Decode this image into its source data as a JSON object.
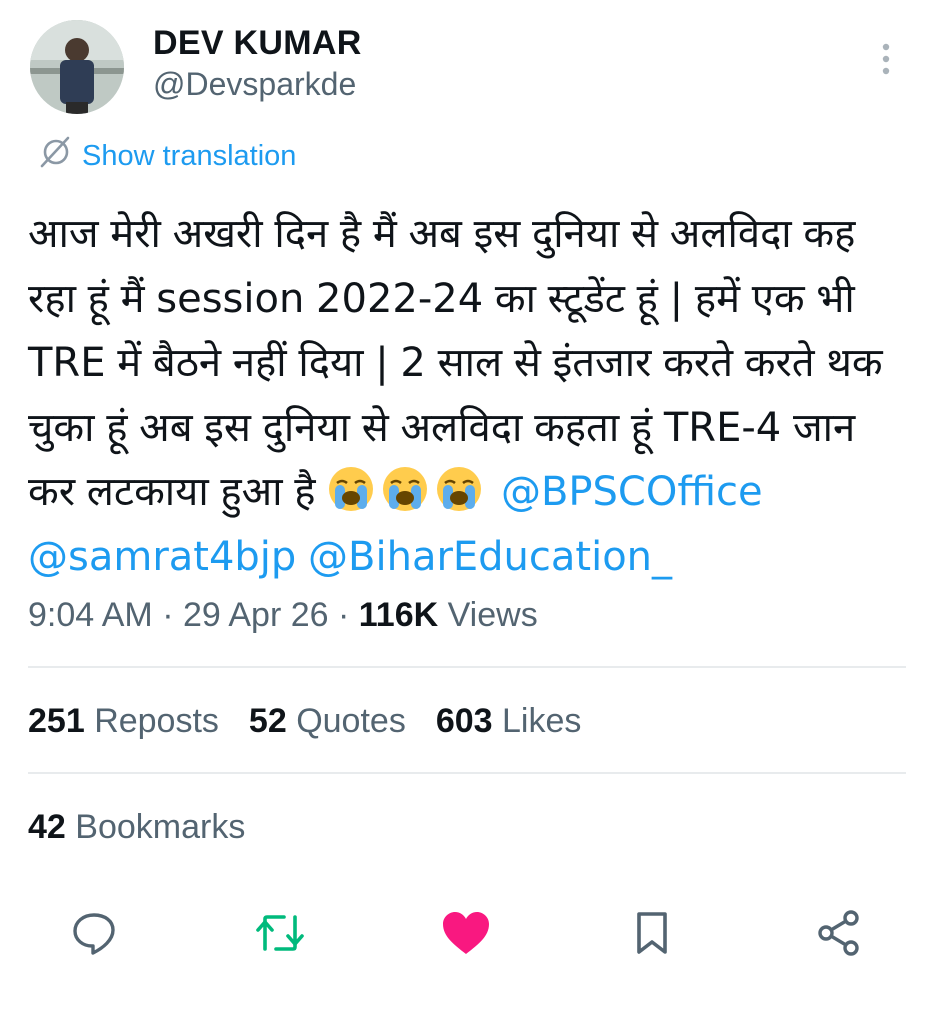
{
  "author": {
    "name": "DEV KUMAR",
    "handle": "@Devsparkde"
  },
  "translation_label": "Show translation",
  "tweet": {
    "text_1": "आज मेरी अखरी दिन है मैं अब इस दुनिया से अलविदा कह रहा हूं मैं session 2022-24 का स्टूडेंट हूं | हमें एक भी TRE में बैठने नहीं दिया | 2 साल से इंतजार करते करते थक चुका हूं अब इस दुनिया से अलविदा कहता हूं TRE-4 जान कर लटकाया हुआ है ",
    "emojis": [
      "loudly-crying-face",
      "loudly-crying-face",
      "loudly-crying-face"
    ],
    "mentions": [
      "@BPSCOffice",
      "@samrat4bjp",
      "@BiharEducation_"
    ]
  },
  "meta": {
    "time": "9:04 AM",
    "date": "29 Apr 26",
    "views_count": "116K",
    "views_label": "Views",
    "separator": " · "
  },
  "stats": {
    "reposts_count": "251",
    "reposts_label": "Reposts",
    "quotes_count": "52",
    "quotes_label": "Quotes",
    "likes_count": "603",
    "likes_label": "Likes",
    "bookmarks_count": "42",
    "bookmarks_label": "Bookmarks"
  },
  "actions": [
    {
      "name": "reply",
      "icon": "reply-icon"
    },
    {
      "name": "repost",
      "icon": "repost-icon",
      "active_color": "#00ba7c"
    },
    {
      "name": "like",
      "icon": "heart-icon",
      "active_color": "#f91880"
    },
    {
      "name": "bookmark",
      "icon": "bookmark-icon"
    },
    {
      "name": "share",
      "icon": "share-icon"
    }
  ],
  "colors": {
    "link": "#1d9bf0",
    "secondary_text": "#536471",
    "primary_text": "#0f1419"
  }
}
